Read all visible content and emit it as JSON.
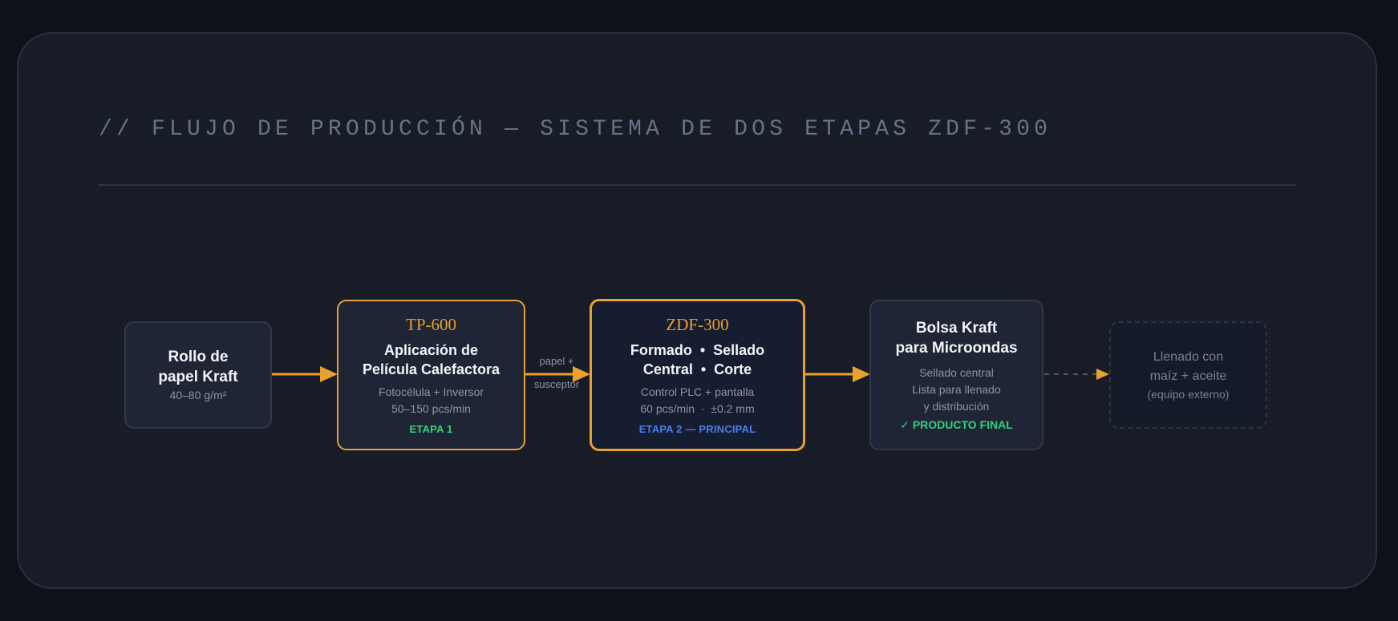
{
  "title": "// FLUJO DE PRODUCCIÓN — SISTEMA DE DOS ETAPAS ZDF-300",
  "colors": {
    "background": "#0d111a",
    "panel": "#181c26",
    "accent": "#e8a030",
    "stage1": "#34d27a",
    "stage2": "#4a7eec",
    "final": "#34d27a",
    "muted": "#8d95a5"
  },
  "nodes": {
    "raw": {
      "name_line1": "Rollo de",
      "name_line2": "papel Kraft",
      "spec": "40–80 g/m²"
    },
    "tp600": {
      "code": "TP-600",
      "name_line1": "Aplicación de",
      "name_line2": "Película Calefactora",
      "detail_line1": "Fotocélula + Inversor",
      "detail_line2": "50–150 pcs/min",
      "stage": "ETAPA 1"
    },
    "zdf300": {
      "code": "ZDF-300",
      "name_line1": "Formado  •  Sellado",
      "name_line2": "Central  •  Corte",
      "detail_line1": "Control PLC + pantalla",
      "detail_line2": "60 pcs/min  ·  ±0.2 mm",
      "stage": "ETAPA 2 — PRINCIPAL"
    },
    "bag": {
      "name_line1": "Bolsa Kraft",
      "name_line2": "para Microondas",
      "detail_line1": "Sellado central",
      "detail_line2": "Lista para llenado",
      "detail_line3": "y distribución",
      "final_label": "✓ PRODUCTO FINAL"
    },
    "fill": {
      "line1": "Llenado con",
      "line2": "maíz + aceite",
      "note": "(equipo externo)"
    }
  },
  "edges": {
    "tp_to_zdf_label_line1": "papel +",
    "tp_to_zdf_label_line2": "susceptor"
  }
}
